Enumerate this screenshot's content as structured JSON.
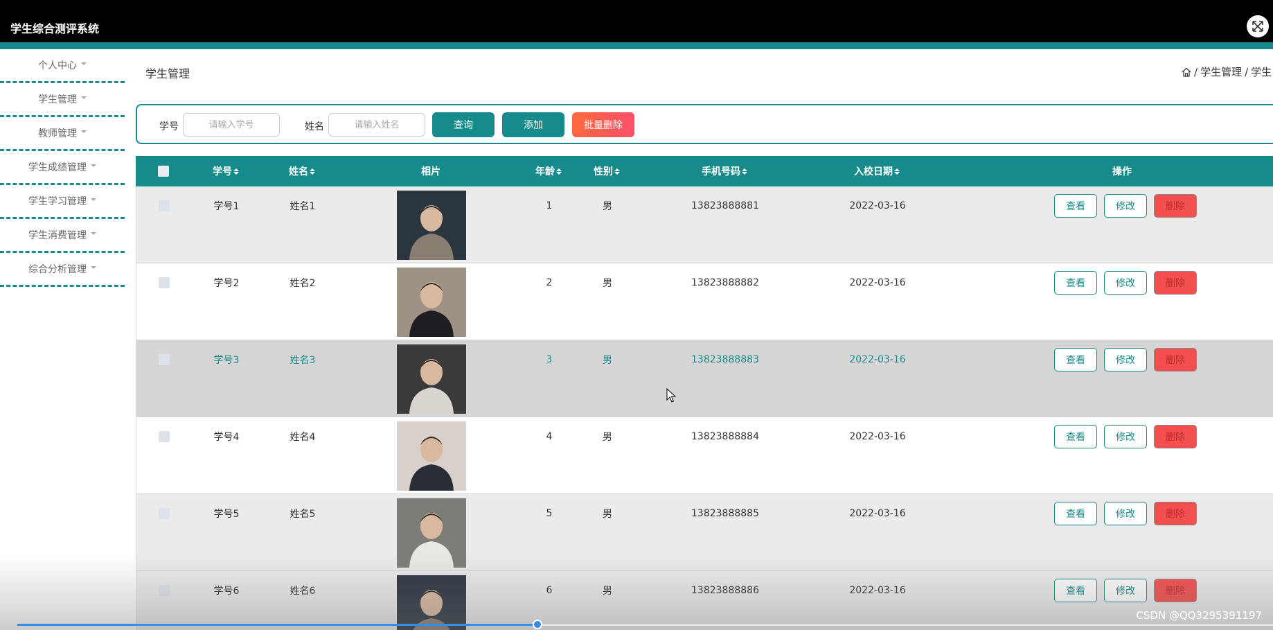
{
  "app": {
    "title": "学生综合测评系统"
  },
  "sidebar": {
    "items": [
      {
        "label": "个人中心"
      },
      {
        "label": "学生管理"
      },
      {
        "label": "教师管理"
      },
      {
        "label": "学生成绩管理"
      },
      {
        "label": "学生学习管理"
      },
      {
        "label": "学生消费管理"
      },
      {
        "label": "综合分析管理"
      }
    ]
  },
  "page": {
    "title": "学生管理",
    "breadcrumb": {
      "sep": "/",
      "level1": "学生管理",
      "level2": "学生"
    }
  },
  "search": {
    "id_label": "学号",
    "id_placeholder": "请输入学号",
    "name_label": "姓名",
    "name_placeholder": "请输入姓名",
    "query_button": "查询",
    "add_button": "添加",
    "batch_delete_button": "批量删除"
  },
  "table": {
    "headers": {
      "id": "学号",
      "name": "姓名",
      "photo": "相片",
      "age": "年龄",
      "gender": "性别",
      "phone": "手机号码",
      "enroll_date": "入校日期",
      "actions": "操作"
    },
    "actions": {
      "view": "查看",
      "edit": "修改",
      "delete": "删除"
    },
    "rows": [
      {
        "id": "学号1",
        "name": "姓名1",
        "age": "1",
        "gender": "男",
        "phone": "13823888881",
        "enroll_date": "2022-03-16"
      },
      {
        "id": "学号2",
        "name": "姓名2",
        "age": "2",
        "gender": "男",
        "phone": "13823888882",
        "enroll_date": "2022-03-16"
      },
      {
        "id": "学号3",
        "name": "姓名3",
        "age": "3",
        "gender": "男",
        "phone": "13823888883",
        "enroll_date": "2022-03-16"
      },
      {
        "id": "学号4",
        "name": "姓名4",
        "age": "4",
        "gender": "男",
        "phone": "13823888884",
        "enroll_date": "2022-03-16"
      },
      {
        "id": "学号5",
        "name": "姓名5",
        "age": "5",
        "gender": "男",
        "phone": "13823888885",
        "enroll_date": "2022-03-16"
      },
      {
        "id": "学号6",
        "name": "姓名6",
        "age": "6",
        "gender": "男",
        "phone": "13823888886",
        "enroll_date": "2022-03-16"
      }
    ]
  },
  "video": {
    "progress": 0.414
  },
  "watermark": "CSDN @QQ3295391197",
  "colors": {
    "accent": "#178b8b",
    "danger": "#f54e4e",
    "topbar": "#000000"
  }
}
